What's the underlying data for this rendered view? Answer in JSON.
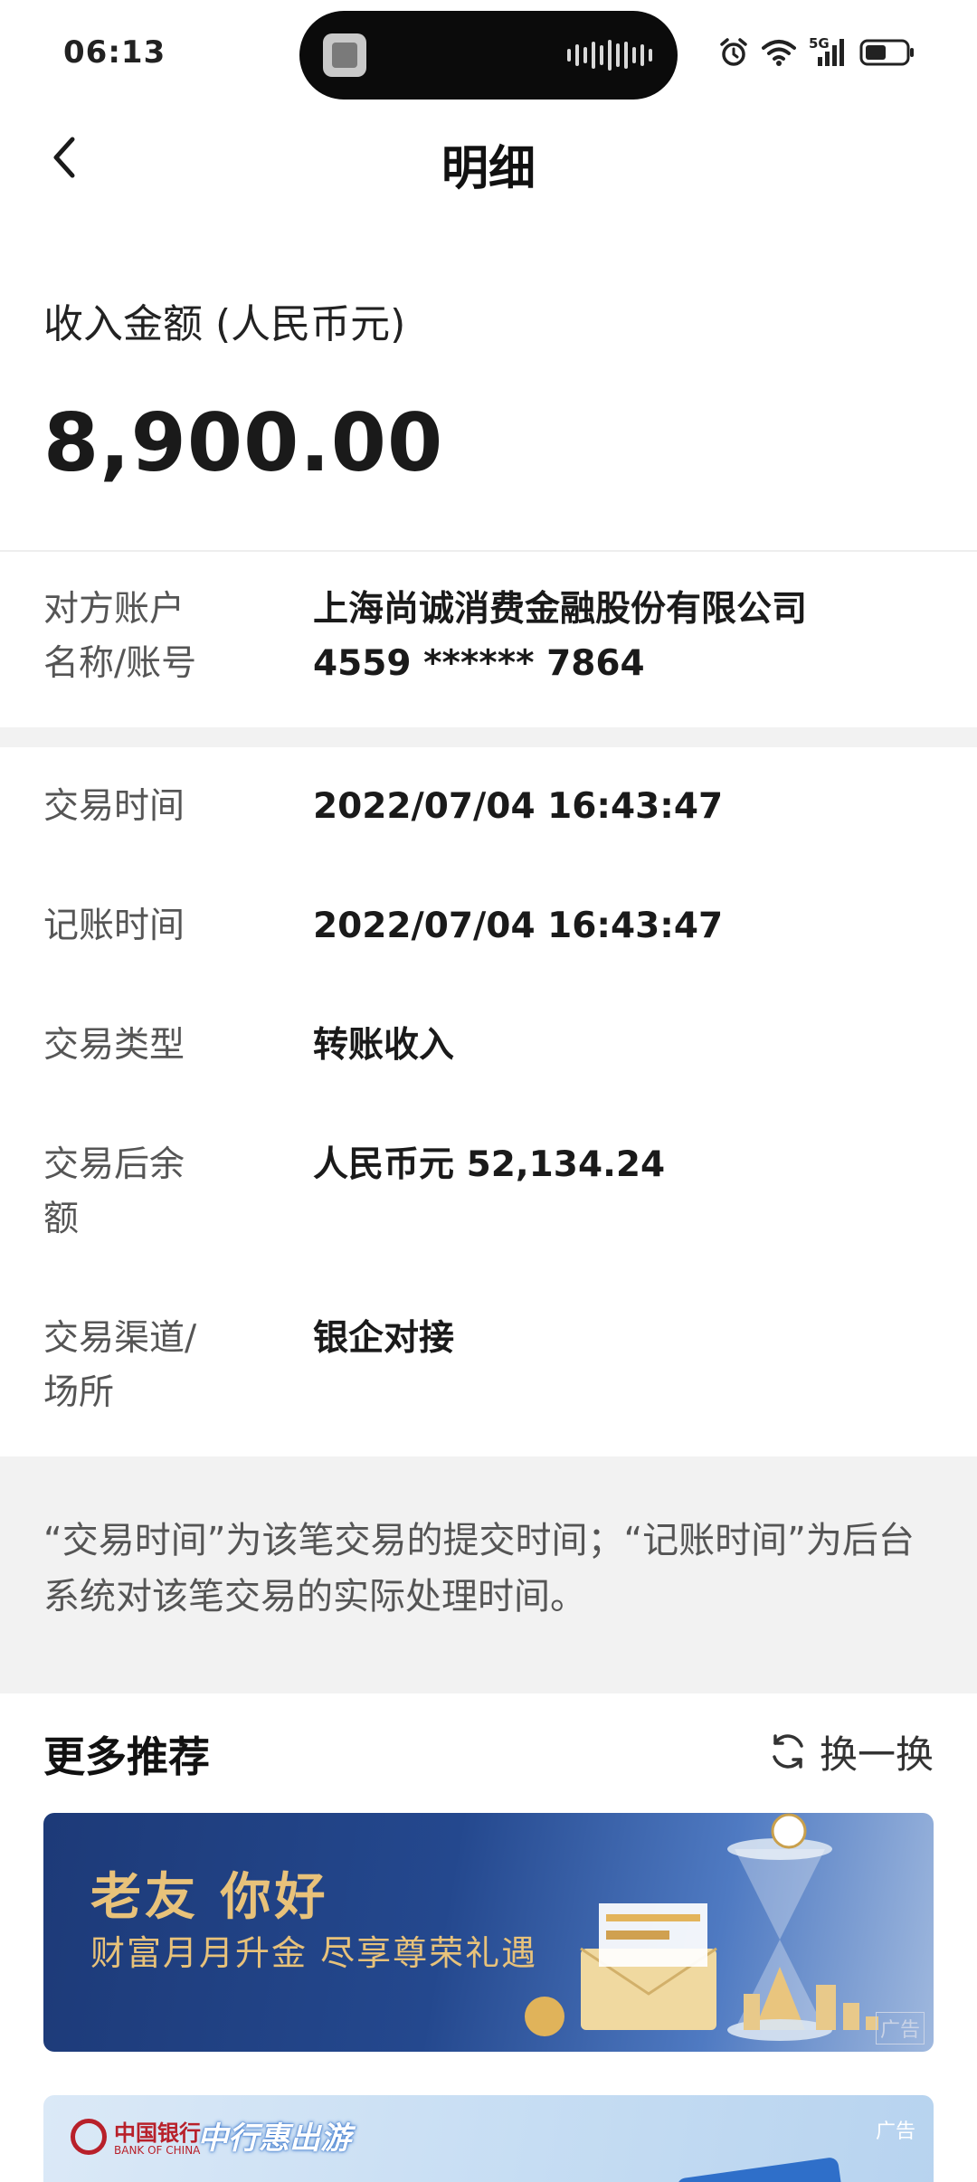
{
  "status_bar": {
    "time": "06:13",
    "network_label": "5G",
    "icons": [
      "alarm-icon",
      "wifi-icon",
      "cellular-signal-icon",
      "battery-icon"
    ]
  },
  "header": {
    "title": "明细",
    "back_icon": "chevron-left-icon"
  },
  "amount": {
    "label": "收入金额 (人民币元)",
    "value": "8,900.00"
  },
  "counterparty": {
    "label": "对方账户\n名称/账号",
    "name": "上海尚诚消费金融股份有限公司",
    "account": "4559 ****** 7864"
  },
  "details": [
    {
      "label": "交易时间",
      "value": "2022/07/04 16:43:47"
    },
    {
      "label": "记账时间",
      "value": "2022/07/04 16:43:47"
    },
    {
      "label": "交易类型",
      "value": "转账收入"
    },
    {
      "label": "交易后余\n额",
      "value": "人民币元 52,134.24"
    },
    {
      "label": "交易渠道/\n场所",
      "value": "银企对接"
    }
  ],
  "note": "“交易时间”为该笔交易的提交时间；“记账时间”为后台系统对该笔交易的实际处理时间。",
  "recommend": {
    "title": "更多推荐",
    "refresh_label": "换一换",
    "banners": [
      {
        "title": "老友 你好",
        "subtitle": "财富月月升金 尽享尊荣礼遇",
        "ad_tag": "广告"
      },
      {
        "bank_name_cn": "中国银行",
        "bank_name_en": "BANK OF CHINA",
        "promo": "中行惠出游",
        "ad_tag": "广告"
      }
    ]
  },
  "colors": {
    "background": "#ffffff",
    "band": "#f2f2f2",
    "banner_gold": "#e8c27a",
    "boc_red": "#b8202a"
  }
}
